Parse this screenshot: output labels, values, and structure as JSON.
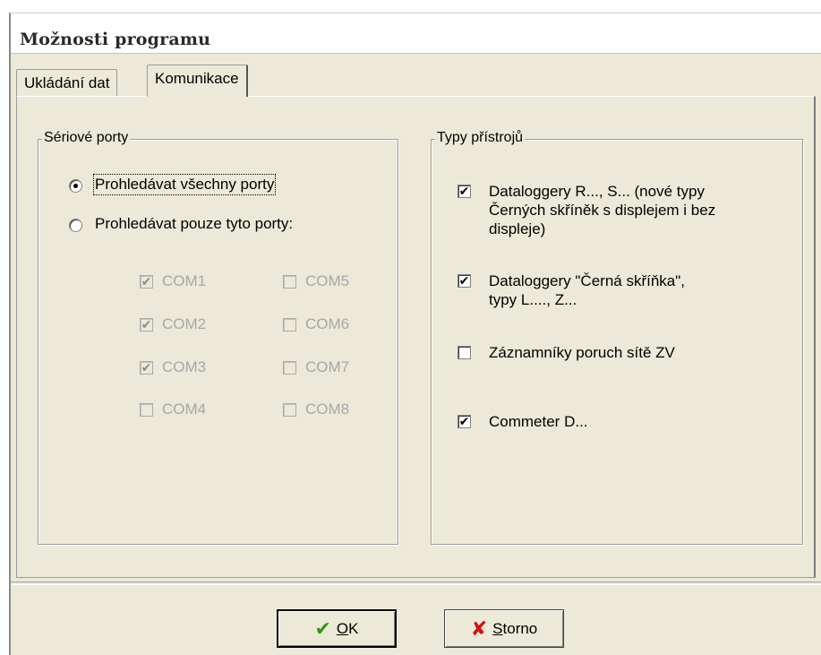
{
  "window": {
    "title": "Možnosti programu"
  },
  "tabs": [
    {
      "label": "Ukládání dat",
      "active": false
    },
    {
      "label": "Komunikace",
      "active": true
    }
  ],
  "serial_ports": {
    "legend": "Sériové porty",
    "radio_all": {
      "label": "Prohledávat všechny porty",
      "checked": true
    },
    "radio_only": {
      "label": "Prohledávat pouze tyto porty:",
      "checked": false
    },
    "ports": [
      {
        "label": "COM1",
        "checked": true
      },
      {
        "label": "COM2",
        "checked": true
      },
      {
        "label": "COM3",
        "checked": true
      },
      {
        "label": "COM4",
        "checked": false
      },
      {
        "label": "COM5",
        "checked": false
      },
      {
        "label": "COM6",
        "checked": false
      },
      {
        "label": "COM7",
        "checked": false
      },
      {
        "label": "COM8",
        "checked": false
      }
    ]
  },
  "device_types": {
    "legend": "Typy přístrojů",
    "items": [
      {
        "label_line1": "Dataloggery R..., S... (nové typy",
        "label_line2": "Černých skříněk s displejem i bez",
        "label_line3": "displeje)",
        "checked": true
      },
      {
        "label_line1": "Dataloggery \"Černá skříňka\",",
        "label_line2": "typy L...., Z...",
        "checked": true
      },
      {
        "label_line1": "Záznamníky poruch sítě ZV",
        "checked": false
      },
      {
        "label_line1": "Commeter D...",
        "checked": true
      }
    ]
  },
  "buttons": {
    "ok": {
      "mnemonic": "O",
      "rest": "K",
      "icon": "checkmark-icon",
      "icon_color": "#2e9a12"
    },
    "cancel": {
      "mnemonic": "S",
      "rest": "torno",
      "icon": "cross-icon",
      "icon_color": "#d41010"
    }
  }
}
